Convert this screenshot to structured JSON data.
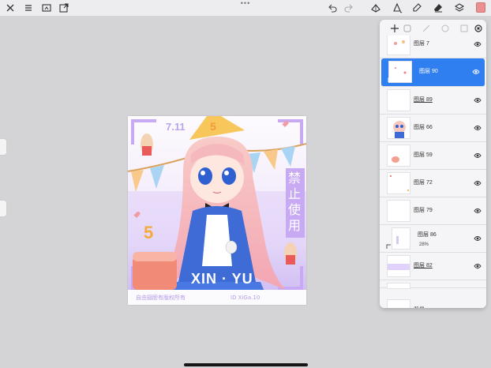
{
  "toolbar": {
    "left_icons": [
      "close-icon",
      "menu-icon",
      "folder-open-icon",
      "export-icon"
    ],
    "right_icons": [
      "undo-icon",
      "redo-icon",
      "adjust-icon",
      "brush-icon",
      "smudge-icon",
      "eraser-icon",
      "layers-icon",
      "color-swatch"
    ],
    "active_color": "#ec8f8f",
    "accent": "#2f7ff0"
  },
  "artwork": {
    "date": "7.11",
    "badge_number": "5",
    "vertical_text": [
      "禁",
      "止",
      "使",
      "用"
    ],
    "name": "XIN · YU",
    "footer_left": "自由翅膀有版权所有",
    "footer_right": "ID XiGa.10"
  },
  "layers": {
    "items": [
      {
        "name": "图层 7",
        "active": false,
        "underlined": false
      },
      {
        "name": "图层 90",
        "active": true,
        "underlined": false
      },
      {
        "name": "图层 89",
        "active": false,
        "underlined": true
      },
      {
        "name": "图层 66",
        "active": false,
        "underlined": false
      },
      {
        "name": "图层 59",
        "active": false,
        "underlined": false
      },
      {
        "name": "图层 72",
        "active": false,
        "underlined": false
      },
      {
        "name": "图层 79",
        "active": false,
        "underlined": false
      },
      {
        "name": "图层 86",
        "active": false,
        "underlined": false,
        "opacity": "28%"
      },
      {
        "name": "图层 82",
        "active": false,
        "underlined": true
      },
      {
        "name": "",
        "active": false,
        "underlined": false
      },
      {
        "name": "背景",
        "active": false,
        "underlined": false
      }
    ]
  }
}
